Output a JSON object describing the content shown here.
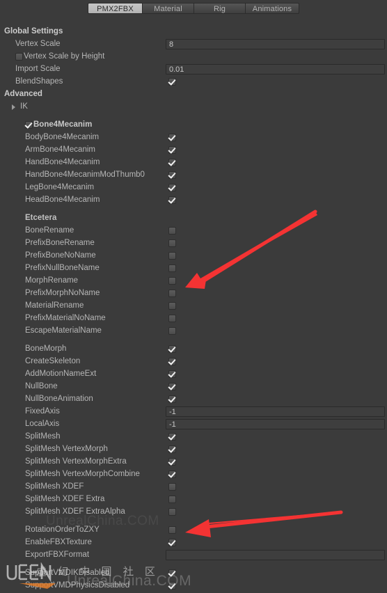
{
  "window": {
    "background_color": "#3b3b3b",
    "accent_color": "#f43333"
  },
  "tabs": [
    {
      "label": "PMX2FBX",
      "active": true
    },
    {
      "label": "Material",
      "active": false
    },
    {
      "label": "Rig",
      "active": false
    },
    {
      "label": "Animations",
      "active": false
    }
  ],
  "sections": {
    "global_settings": "Global Settings",
    "advanced": "Advanced",
    "ik": "IK",
    "bone4mecanim": "Bone4Mecanim",
    "etcetera": "Etcetera"
  },
  "rows": [
    {
      "label": "Vertex Scale",
      "type": "field",
      "value": "8"
    },
    {
      "label": "Vertex Scale by Height",
      "type": "checkbox-inline",
      "checked": false
    },
    {
      "label": "Import Scale",
      "type": "field",
      "value": "0.01"
    },
    {
      "label": "BlendShapes",
      "type": "checkbox",
      "checked": true
    },
    {
      "label": "BodyBone4Mecanim",
      "type": "checkbox",
      "checked": true
    },
    {
      "label": "ArmBone4Mecanim",
      "type": "checkbox",
      "checked": true
    },
    {
      "label": "HandBone4Mecanim",
      "type": "checkbox",
      "checked": true
    },
    {
      "label": "HandBone4MecanimModThumb0",
      "type": "checkbox",
      "checked": true
    },
    {
      "label": "LegBone4Mecanim",
      "type": "checkbox",
      "checked": true
    },
    {
      "label": "HeadBone4Mecanim",
      "type": "checkbox",
      "checked": true
    },
    {
      "label": "BoneRename",
      "type": "checkbox",
      "checked": false
    },
    {
      "label": "PrefixBoneRename",
      "type": "checkbox",
      "checked": false
    },
    {
      "label": "PrefixBoneNoName",
      "type": "checkbox",
      "checked": false
    },
    {
      "label": "PrefixNullBoneName",
      "type": "checkbox",
      "checked": false
    },
    {
      "label": "MorphRename",
      "type": "checkbox",
      "checked": false
    },
    {
      "label": "PrefixMorphNoName",
      "type": "checkbox",
      "checked": false
    },
    {
      "label": "MaterialRename",
      "type": "checkbox",
      "checked": false
    },
    {
      "label": "PrefixMaterialNoName",
      "type": "checkbox",
      "checked": false
    },
    {
      "label": "EscapeMaterialName",
      "type": "checkbox",
      "checked": false
    },
    {
      "label": "BoneMorph",
      "type": "checkbox",
      "checked": true
    },
    {
      "label": "CreateSkeleton",
      "type": "checkbox",
      "checked": true
    },
    {
      "label": "AddMotionNameExt",
      "type": "checkbox",
      "checked": true
    },
    {
      "label": "NullBone",
      "type": "checkbox",
      "checked": true
    },
    {
      "label": "NullBoneAnimation",
      "type": "checkbox",
      "checked": true
    },
    {
      "label": "FixedAxis",
      "type": "field",
      "value": "-1"
    },
    {
      "label": "LocalAxis",
      "type": "field",
      "value": "-1"
    },
    {
      "label": "SplitMesh",
      "type": "checkbox",
      "checked": true
    },
    {
      "label": "SplitMesh VertexMorph",
      "type": "checkbox",
      "checked": true
    },
    {
      "label": "SplitMesh VertexMorphExtra",
      "type": "checkbox",
      "checked": true
    },
    {
      "label": "SplitMesh VertexMorphCombine",
      "type": "checkbox",
      "checked": true
    },
    {
      "label": "SplitMesh XDEF",
      "type": "checkbox",
      "checked": false
    },
    {
      "label": "SplitMesh XDEF Extra",
      "type": "checkbox",
      "checked": false
    },
    {
      "label": "SplitMesh XDEF ExtraAlpha",
      "type": "checkbox",
      "checked": false
    },
    {
      "label": "RotationOrderToZXY",
      "type": "checkbox",
      "checked": false
    },
    {
      "label": "EnableFBXTexture",
      "type": "checkbox",
      "checked": true
    },
    {
      "label": "ExportFBXFormat",
      "type": "field",
      "value": ""
    },
    {
      "label": "SupportVMDIKDisabled",
      "type": "checkbox",
      "checked": true
    },
    {
      "label": "SupportVMDPhysicsDisabled",
      "type": "checkbox",
      "checked": true
    }
  ],
  "annotations": {
    "arrow_1_target": "MorphRename",
    "arrow_2_target": "RotationOrderToZXY",
    "arrow_color": "#f43333"
  },
  "watermark": {
    "logo_text": "UECN",
    "chinese": "虚 幻 中 国 社 区",
    "site_mid": "UnrealChina.COM",
    "site_bottom": "UnrealChina.COM"
  }
}
